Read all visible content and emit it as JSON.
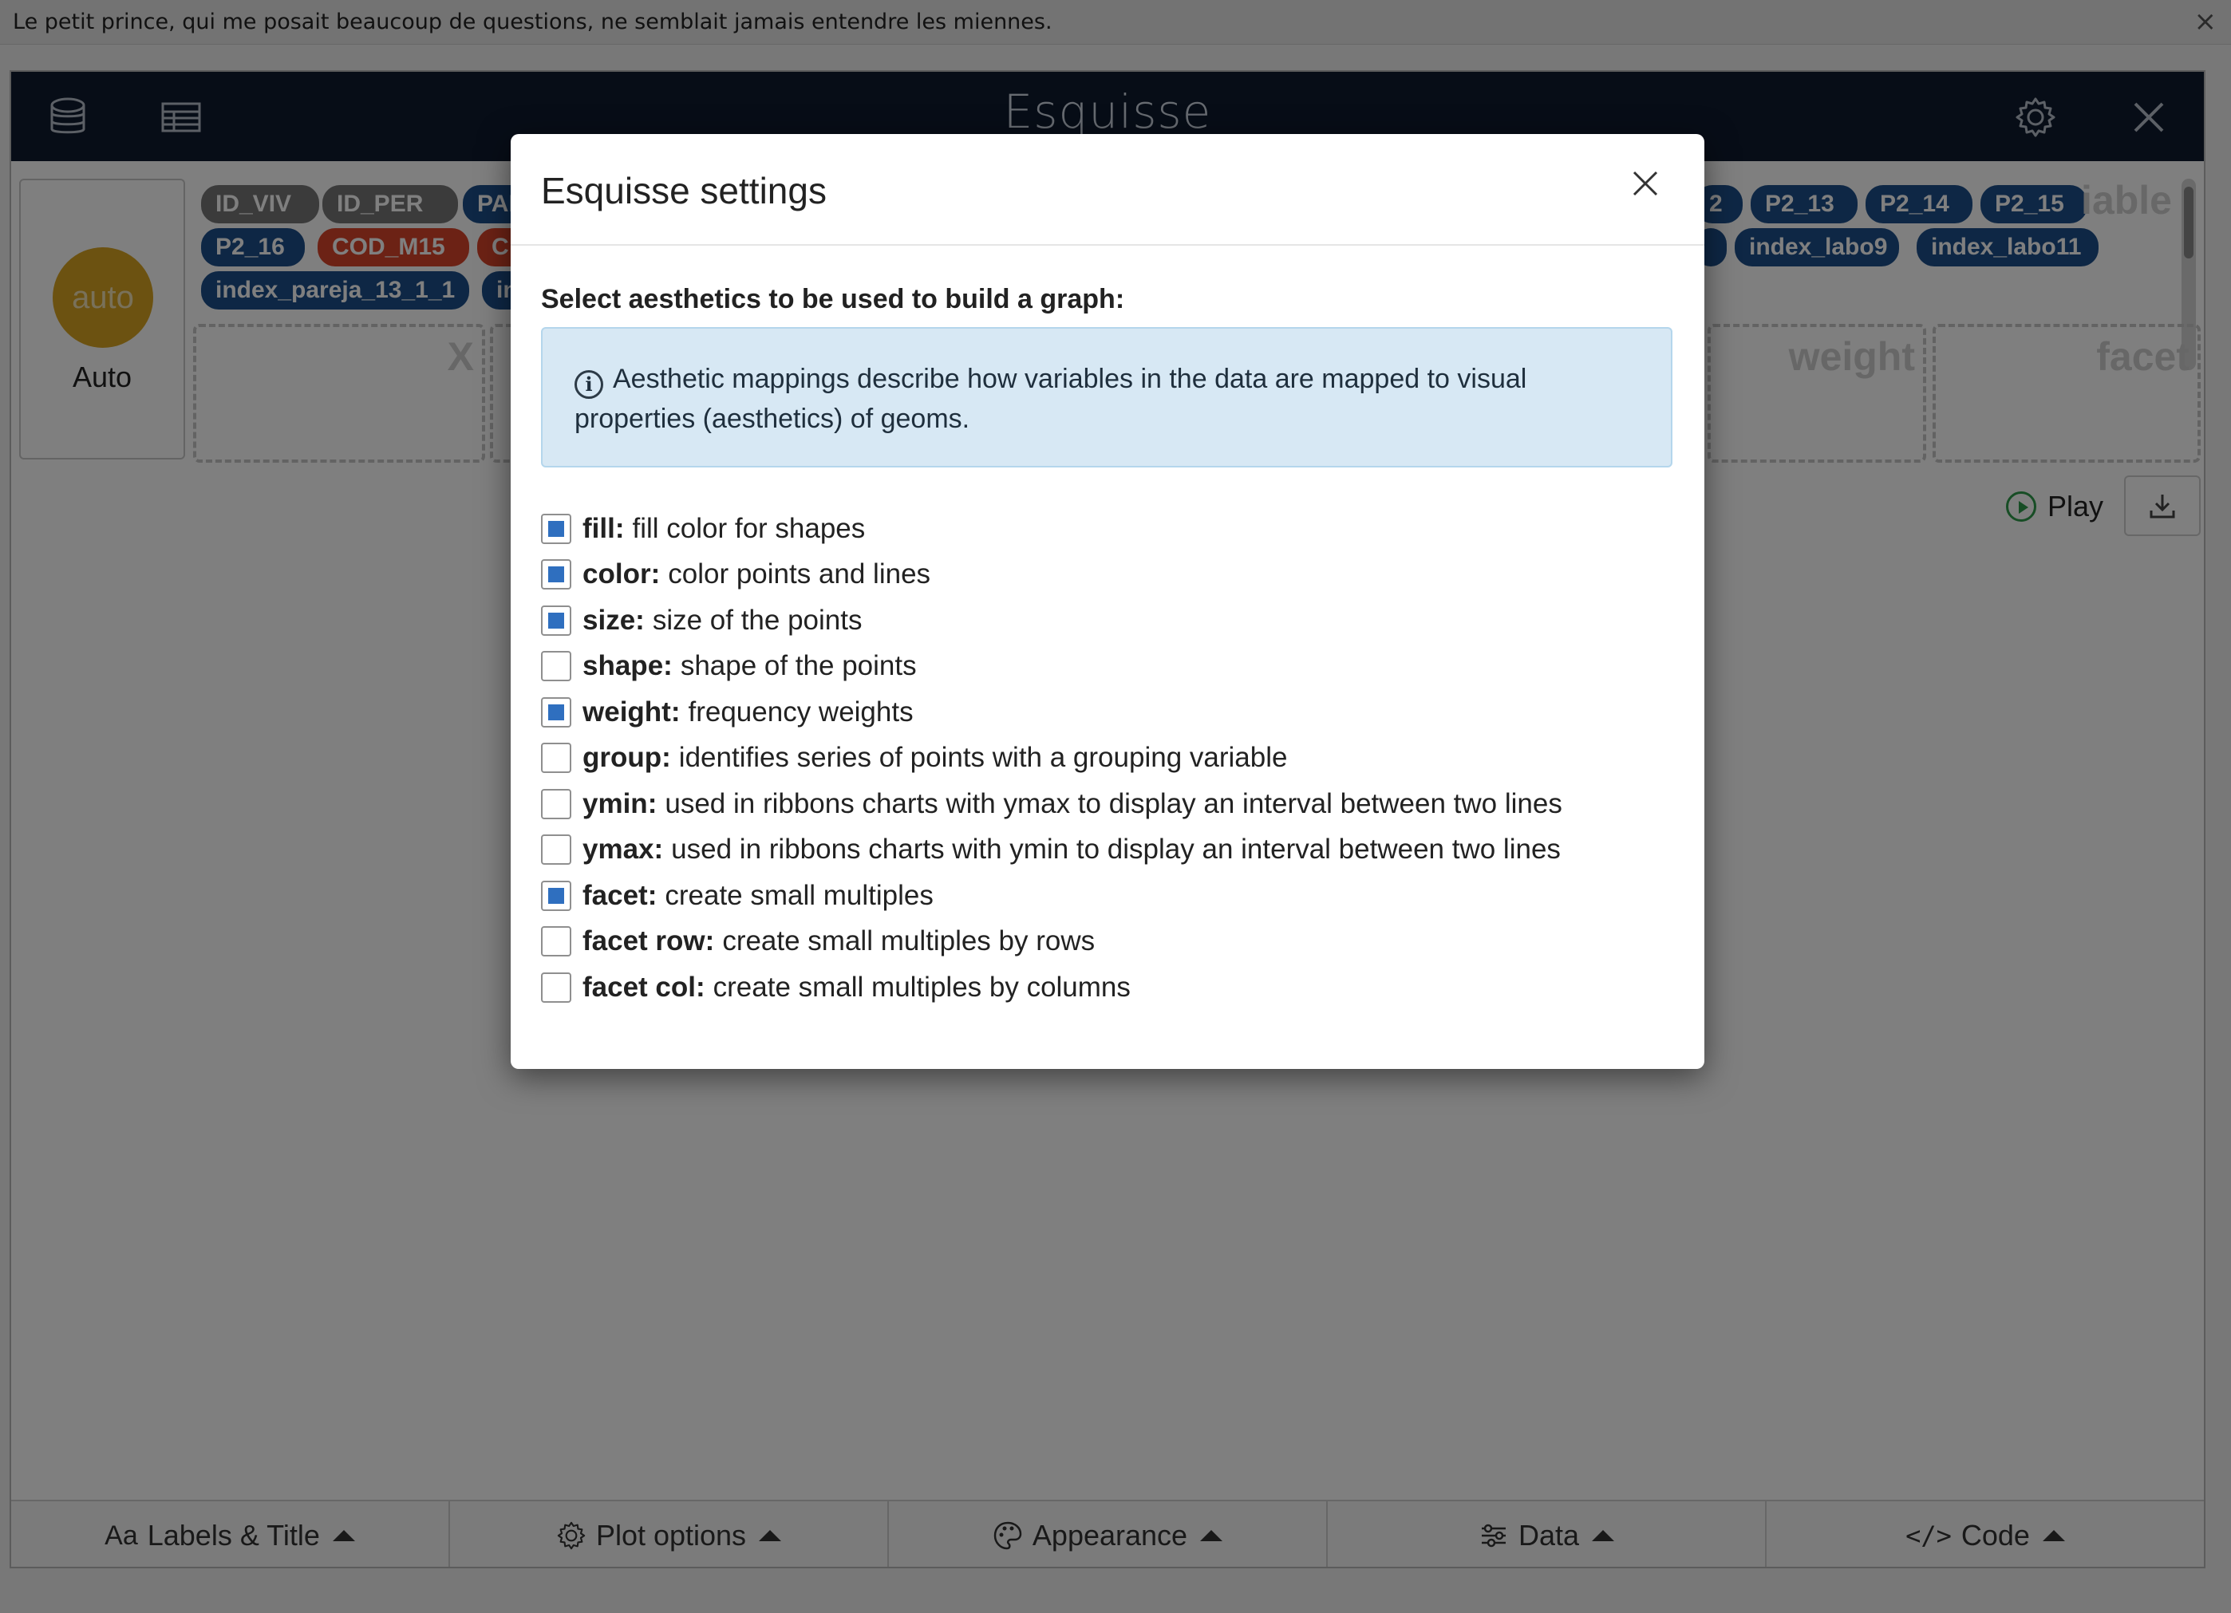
{
  "banner": {
    "text": "Le petit prince, qui me posait beaucoup de questions, ne semblait jamais entendre les miennes.",
    "close": "×"
  },
  "app": {
    "title": "Esquisse",
    "geom": {
      "circle_label": "auto",
      "label": "Auto"
    },
    "chips": [
      {
        "label": "ID_VIV",
        "color": "gray"
      },
      {
        "label": "ID_PER",
        "color": "gray"
      },
      {
        "label": "PAR",
        "color": "blue"
      },
      {
        "label": "P2_16",
        "color": "blue"
      },
      {
        "label": "COD_M15",
        "color": "red"
      },
      {
        "label": "C",
        "color": "red"
      },
      {
        "label": "index_pareja_13_1_1",
        "color": "blue"
      },
      {
        "label": "in",
        "color": "blue"
      },
      {
        "label": "2",
        "color": "blue"
      },
      {
        "label": "P2_13",
        "color": "blue"
      },
      {
        "label": "P2_14",
        "color": "blue"
      },
      {
        "label": "P2_15",
        "color": "blue"
      },
      {
        "label": "",
        "color": "blue"
      },
      {
        "label": "index_labo9",
        "color": "blue"
      },
      {
        "label": "index_labo11",
        "color": "blue"
      }
    ],
    "variable_ghost": "iable",
    "dropzones": {
      "x": "X",
      "weight": "weight",
      "facet": "facet"
    },
    "play_label": "Play",
    "bottom_tabs": [
      {
        "label": "Labels & Title",
        "icon": "text-aa-icon"
      },
      {
        "label": "Plot options",
        "icon": "gear-icon"
      },
      {
        "label": "Appearance",
        "icon": "palette-icon"
      },
      {
        "label": "Data",
        "icon": "sliders-icon"
      },
      {
        "label": "Code",
        "icon": "code-icon"
      }
    ]
  },
  "modal": {
    "title": "Esquisse settings",
    "section_title": "Select aesthetics to be used to build a graph:",
    "info_text": "Aesthetic mappings describe how variables in the data are mapped to visual properties (aesthetics) of geoms.",
    "options": [
      {
        "name": "fill:",
        "desc": "fill color for shapes",
        "checked": true
      },
      {
        "name": "color:",
        "desc": "color points and lines",
        "checked": true
      },
      {
        "name": "size:",
        "desc": "size of the points",
        "checked": true
      },
      {
        "name": "shape:",
        "desc": "shape of the points",
        "checked": false
      },
      {
        "name": "weight:",
        "desc": "frequency weights",
        "checked": true
      },
      {
        "name": "group:",
        "desc": "identifies series of points with a grouping variable",
        "checked": false
      },
      {
        "name": "ymin:",
        "desc": "used in ribbons charts with ymax to display an interval between two lines",
        "checked": false
      },
      {
        "name": "ymax:",
        "desc": "used in ribbons charts with ymin to display an interval between two lines",
        "checked": false
      },
      {
        "name": "facet:",
        "desc": "create small multiples",
        "checked": true
      },
      {
        "name": "facet row:",
        "desc": "create small multiples by rows",
        "checked": false
      },
      {
        "name": "facet col:",
        "desc": "create small multiples by columns",
        "checked": false
      }
    ]
  },
  "colors": {
    "header_bg": "#0f1a2e",
    "checkbox_fill": "#2f6fbf",
    "chip_blue": "#1d4f8a",
    "chip_red": "#d9452b",
    "chip_gray": "#777777",
    "geom_auto": "#d9a423"
  }
}
